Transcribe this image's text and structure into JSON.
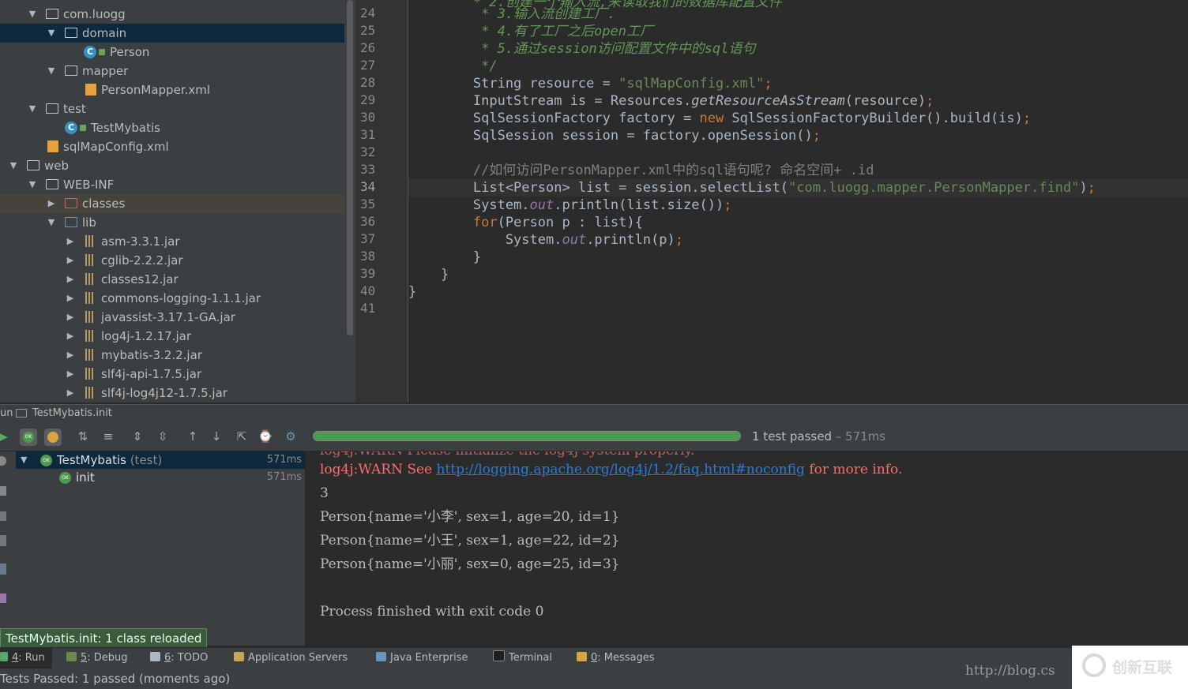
{
  "project_tree": [
    {
      "label": "com.luogg",
      "depth": 1,
      "expanded": true,
      "icon": "package-folder-icon"
    },
    {
      "label": "domain",
      "depth": 2,
      "expanded": true,
      "icon": "package-folder-icon",
      "selected": true
    },
    {
      "label": "Person",
      "depth": 3,
      "icon": "class-icon"
    },
    {
      "label": "mapper",
      "depth": 2,
      "expanded": true,
      "icon": "package-folder-icon"
    },
    {
      "label": "PersonMapper.xml",
      "depth": 3,
      "icon": "xml-file-icon"
    },
    {
      "label": "test",
      "depth": 1,
      "expanded": true,
      "icon": "package-folder-icon"
    },
    {
      "label": "TestMybatis",
      "depth": 2,
      "icon": "test-class-icon"
    },
    {
      "label": "sqlMapConfig.xml",
      "depth": 1,
      "icon": "xml-file-icon"
    },
    {
      "label": "web",
      "depth": 0,
      "expanded": true,
      "icon": "web-folder-icon"
    },
    {
      "label": "WEB-INF",
      "depth": 1,
      "expanded": true,
      "icon": "folder-icon"
    },
    {
      "label": "classes",
      "depth": 2,
      "expanded": false,
      "icon": "excluded-folder-icon",
      "highlighted": true
    },
    {
      "label": "lib",
      "depth": 2,
      "expanded": true,
      "icon": "library-folder-icon"
    },
    {
      "label": "asm-3.3.1.jar",
      "depth": 3,
      "expanded": false,
      "icon": "jar-icon"
    },
    {
      "label": "cglib-2.2.2.jar",
      "depth": 3,
      "expanded": false,
      "icon": "jar-icon"
    },
    {
      "label": "classes12.jar",
      "depth": 3,
      "expanded": false,
      "icon": "jar-icon"
    },
    {
      "label": "commons-logging-1.1.1.jar",
      "depth": 3,
      "expanded": false,
      "icon": "jar-icon"
    },
    {
      "label": "javassist-3.17.1-GA.jar",
      "depth": 3,
      "expanded": false,
      "icon": "jar-icon"
    },
    {
      "label": "log4j-1.2.17.jar",
      "depth": 3,
      "expanded": false,
      "icon": "jar-icon"
    },
    {
      "label": "mybatis-3.2.2.jar",
      "depth": 3,
      "expanded": false,
      "icon": "jar-icon"
    },
    {
      "label": "slf4j-api-1.7.5.jar",
      "depth": 3,
      "expanded": false,
      "icon": "jar-icon"
    },
    {
      "label": "slf4j-log4j12-1.7.5.jar",
      "depth": 3,
      "expanded": false,
      "icon": "jar-icon"
    }
  ],
  "editor": {
    "line_numbers": [
      "24",
      "25",
      "26",
      "27",
      "28",
      "29",
      "30",
      "31",
      "32",
      "33",
      "34",
      "35",
      "36",
      "37",
      "38",
      "39",
      "40",
      "41"
    ],
    "current_line": "34"
  },
  "run_panel": {
    "tab_label": "un",
    "config_name": "TestMybatis.init",
    "progress_fraction": 1.0,
    "status": "1 test passed",
    "status_time": " – 571ms",
    "tests": [
      {
        "name": "TestMybatis",
        "suffix": " (test)",
        "time": "571ms",
        "expanded": true
      },
      {
        "name": "init",
        "time": "571ms"
      }
    ],
    "console": {
      "warn_prefix": "log4j:WARN See ",
      "warn_link": "http://logging.apache.org/log4j/1.2/faq.html#noconfig",
      "warn_suffix": " for more info.",
      "lines": [
        "3",
        "Person{name='小李', sex=1, age=20, id=1}",
        "Person{name='小王', sex=1, age=22, id=2}",
        "Person{name='小丽', sex=0, age=25, id=3}",
        "",
        "Process finished with exit code 0"
      ]
    },
    "reload_tip": "TestMybatis.init: 1 class reloaded"
  },
  "bottom_tabs": [
    {
      "num": "4",
      "label": ": Run",
      "active": true
    },
    {
      "num": "5",
      "label": ": Debug"
    },
    {
      "num": "6",
      "label": ": TODO"
    },
    {
      "num": "",
      "label": "Application Servers"
    },
    {
      "num": "",
      "label": "Java Enterprise"
    },
    {
      "num": "",
      "label": "Terminal"
    },
    {
      "num": "0",
      "label": ": Messages"
    }
  ],
  "status_bar": "Tests Passed: 1 passed (moments ago)",
  "watermark": {
    "url_text": "http://blog.cs",
    "brand": "创新互联"
  },
  "colors": {
    "pass_green": "#499c54",
    "selection": "#0d293e",
    "keyword": "#cc7832",
    "string": "#6a8759",
    "comment": "#808080"
  }
}
